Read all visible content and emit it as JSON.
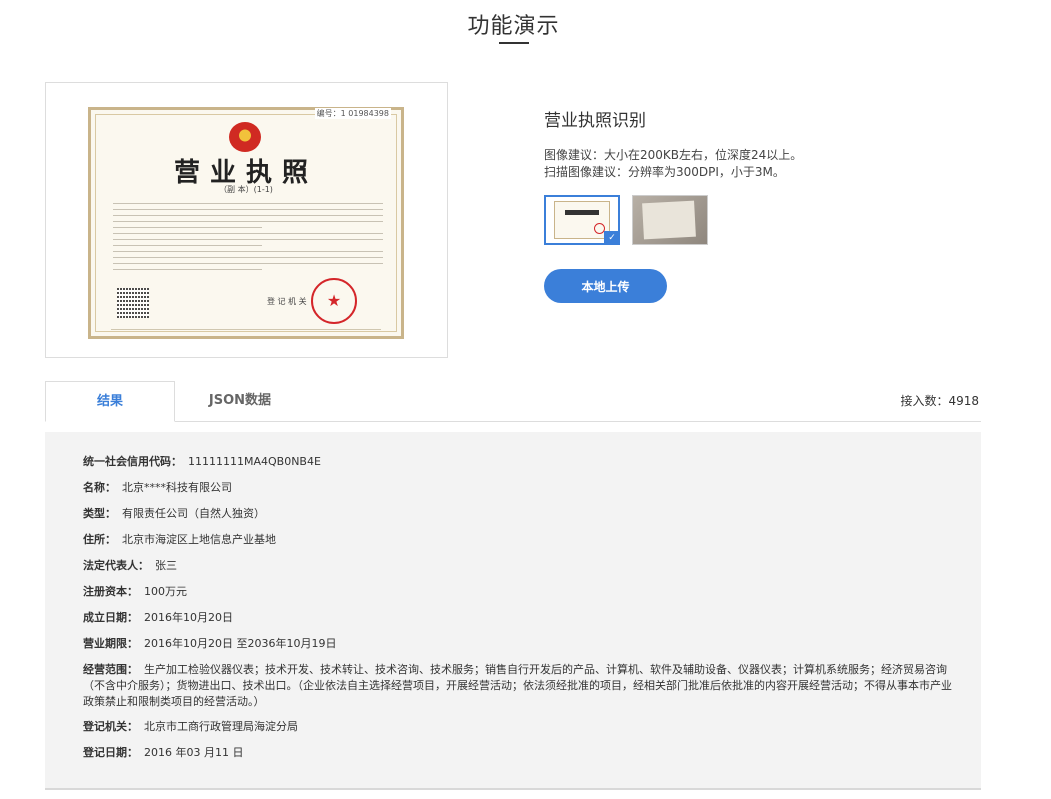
{
  "page": {
    "title": "功能演示"
  },
  "preview": {
    "serial": "编号：1 01984398",
    "license_title": "营业执照",
    "license_subtitle": "（副 本）(1-1)",
    "registration_label": "登 记 机 关"
  },
  "panel": {
    "title": "营业执照识别",
    "hint_image": "图像建议：大小在200KB左右，位深度24以上。",
    "hint_scan": "扫描图像建议：分辨率为300DPI，小于3M。",
    "upload_label": "本地上传"
  },
  "tabs": {
    "result_label": "结果",
    "json_label": "JSON数据",
    "call_count": "接入数：4918"
  },
  "result": {
    "fields": [
      {
        "key": "统一社会信用代码：",
        "value": "11111111MA4QB0NB4E"
      },
      {
        "key": "名称：",
        "value": "北京****科技有限公司"
      },
      {
        "key": "类型：",
        "value": "有限责任公司（自然人独资）"
      },
      {
        "key": "住所：",
        "value": "北京市海淀区上地信息产业基地"
      },
      {
        "key": "法定代表人：",
        "value": "张三"
      },
      {
        "key": "注册资本：",
        "value": "100万元"
      },
      {
        "key": "成立日期：",
        "value": "2016年10月20日"
      },
      {
        "key": "营业期限：",
        "value": "2016年10月20日 至2036年10月19日"
      },
      {
        "key": "经营范围：",
        "value": "生产加工检验仪器仪表；技术开发、技术转让、技术咨询、技术服务；销售自行开发后的产品、计算机、软件及辅助设备、仪器仪表；计算机系统服务；经济贸易咨询（不含中介服务）；货物进出口、技术出口。（企业依法自主选择经营项目，开展经营活动；依法须经批准的项目，经相关部门批准后依批准的内容开展经营活动；不得从事本市产业政策禁止和限制类项目的经营活动。）"
      },
      {
        "key": "登记机关：",
        "value": "北京市工商行政管理局海淀分局"
      },
      {
        "key": "登记日期：",
        "value": "2016 年03 月11 日"
      }
    ]
  }
}
